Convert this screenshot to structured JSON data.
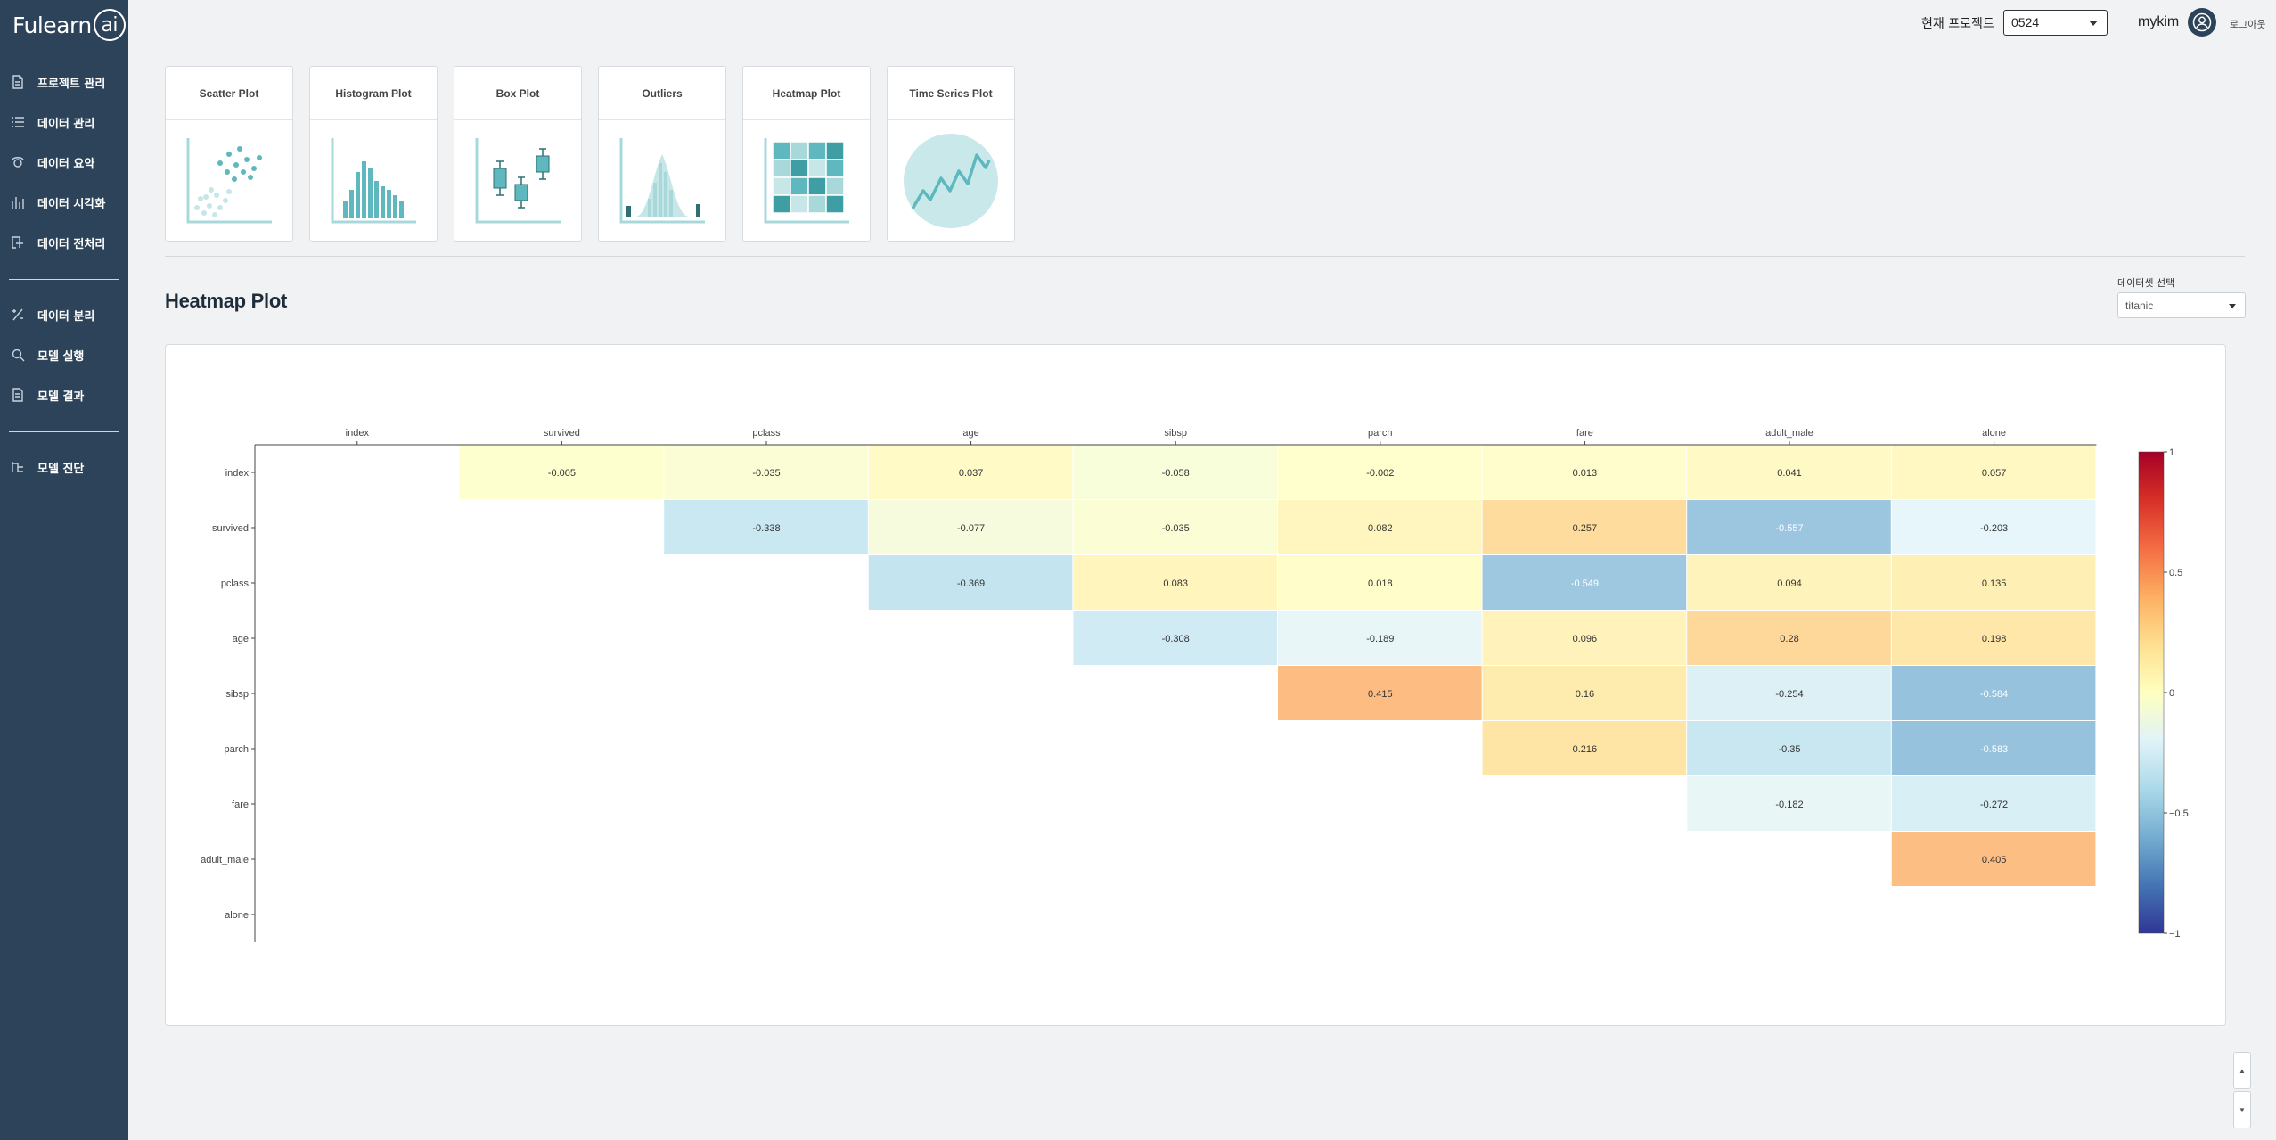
{
  "app": {
    "logo_text": "Fulearn",
    "logo_ai": "ai"
  },
  "sidebar": {
    "items": [
      {
        "label": "프로젝트 관리",
        "icon": "document-icon"
      },
      {
        "label": "데이터 관리",
        "icon": "list-icon"
      },
      {
        "label": "데이터 요약",
        "icon": "summary-icon"
      },
      {
        "label": "데이터 시각화",
        "icon": "bar-chart-icon"
      },
      {
        "label": "데이터 전처리",
        "icon": "preprocess-icon"
      },
      {
        "label": "데이터 분리",
        "icon": "split-icon"
      },
      {
        "label": "모델 실행",
        "icon": "search-icon"
      },
      {
        "label": "모델 결과",
        "icon": "result-document-icon"
      },
      {
        "label": "모델 진단",
        "icon": "diagnosis-icon"
      }
    ]
  },
  "header": {
    "project_label": "현재 프로젝트",
    "project_value": "0524",
    "username": "mykim",
    "logout_label": "로그아웃"
  },
  "plot_types": [
    {
      "label": "Scatter Plot"
    },
    {
      "label": "Histogram Plot"
    },
    {
      "label": "Box Plot"
    },
    {
      "label": "Outliers"
    },
    {
      "label": "Heatmap Plot"
    },
    {
      "label": "Time Series Plot"
    }
  ],
  "section": {
    "title": "Heatmap Plot"
  },
  "dataset": {
    "label": "데이터셋 선택",
    "value": "titanic"
  },
  "colors": {
    "sidebar": "#2d4359",
    "accent": "#5fb8bd"
  },
  "chart_data": {
    "type": "heatmap",
    "x_labels": [
      "index",
      "survived",
      "pclass",
      "age",
      "sibsp",
      "parch",
      "fare",
      "adult_male",
      "alone"
    ],
    "y_labels": [
      "index",
      "survived",
      "pclass",
      "age",
      "sibsp",
      "parch",
      "fare",
      "adult_male",
      "alone"
    ],
    "values": [
      [
        null,
        -0.005,
        -0.035,
        0.037,
        -0.058,
        -0.002,
        0.013,
        0.041,
        0.057
      ],
      [
        null,
        null,
        -0.338,
        -0.077,
        -0.035,
        0.082,
        0.257,
        -0.557,
        -0.203
      ],
      [
        null,
        null,
        null,
        -0.369,
        0.083,
        0.018,
        -0.549,
        0.094,
        0.135
      ],
      [
        null,
        null,
        null,
        null,
        -0.308,
        -0.189,
        0.096,
        0.28,
        0.198
      ],
      [
        null,
        null,
        null,
        null,
        null,
        0.415,
        0.16,
        -0.254,
        -0.584
      ],
      [
        null,
        null,
        null,
        null,
        null,
        null,
        0.216,
        -0.35,
        -0.583
      ],
      [
        null,
        null,
        null,
        null,
        null,
        null,
        null,
        -0.182,
        -0.272
      ],
      [
        null,
        null,
        null,
        null,
        null,
        null,
        null,
        null,
        0.405
      ],
      [
        null,
        null,
        null,
        null,
        null,
        null,
        null,
        null,
        null
      ]
    ],
    "colorscale": "RdYlBu_r",
    "zlim": [
      -1,
      1
    ],
    "colorbar_ticks": [
      "1",
      "0.5",
      "0",
      "−0.5",
      "−1"
    ],
    "colorbar_tick_values": [
      1,
      0.5,
      0,
      -0.5,
      -1
    ]
  }
}
